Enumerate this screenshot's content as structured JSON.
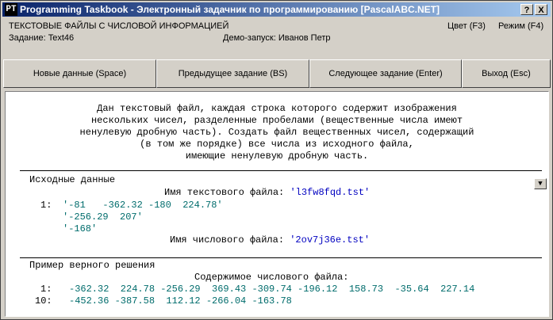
{
  "window": {
    "title": "Programming Taskbook - Электронный задачник по программированию [PascalABC.NET]",
    "help_label": "?",
    "close_label": "X",
    "app_icon": "PT"
  },
  "header": {
    "section": "ТЕКСТОВЫЕ ФАЙЛЫ С ЧИСЛОВОЙ ИНФОРМАЦИЕЙ",
    "task": "Задание: Text46",
    "demo": "Демо-запуск: Иванов Петр",
    "color_label": "Цвет (F3)",
    "mode_label": "Режим (F4)"
  },
  "buttons": {
    "new_data": "Новые данные (Space)",
    "prev_task": "Предыдущее задание (BS)",
    "next_task": "Следующее задание (Enter)",
    "exit": "Выход (Esc)"
  },
  "task_text": [
    "Дан текстовый файл, каждая строка которого содержит изображения",
    "нескольких чисел, разделенные пробелами (вещественные числа имеют",
    "ненулевую дробную часть). Создать файл вещественных чисел, содержащий",
    "(в том же порядке) все числа из исходного файла,",
    "имеющие ненулевую дробную часть."
  ],
  "source": {
    "heading": "Исходные данные",
    "text_file_label": "Имя текстового файла: ",
    "text_file_name": "'l3fw8fqd.tst'",
    "line_num": "1:",
    "lines": [
      "'-81   -362.32 -180  224.78'",
      "'-256.29  207'",
      "'-168'"
    ],
    "num_file_label": "Имя числового файла: ",
    "num_file_name": "'2ov7j36e.tst'",
    "collapse_icon": "▼"
  },
  "solution": {
    "heading": "Пример верного решения",
    "content_label": "Содержимое числового файла:",
    "row1_num": "1:",
    "row1": "-362.32  224.78 -256.29  369.43 -309.74 -196.12  158.73  -35.64  227.14",
    "row2_num": "10:",
    "row2": "-452.36 -387.58  112.12 -266.04 -163.78"
  }
}
